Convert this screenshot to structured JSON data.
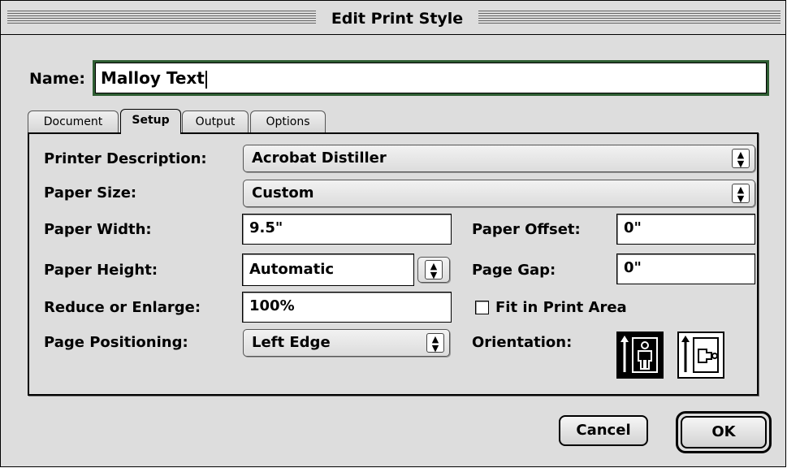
{
  "window": {
    "title": "Edit Print Style"
  },
  "name": {
    "label": "Name:",
    "value": "Malloy Text"
  },
  "tabs": [
    {
      "label": "Document",
      "active": false
    },
    {
      "label": "Setup",
      "active": true
    },
    {
      "label": "Output",
      "active": false
    },
    {
      "label": "Options",
      "active": false
    }
  ],
  "setup": {
    "printer_description": {
      "label": "Printer Description:",
      "value": "Acrobat Distiller"
    },
    "paper_size": {
      "label": "Paper Size:",
      "value": "Custom"
    },
    "paper_width": {
      "label": "Paper Width:",
      "value": "9.5\""
    },
    "paper_height": {
      "label": "Paper Height:",
      "value": "Automatic"
    },
    "reduce_enlarge": {
      "label": "Reduce or Enlarge:",
      "value": "100%"
    },
    "page_positioning": {
      "label": "Page Positioning:",
      "value": "Left Edge"
    },
    "paper_offset": {
      "label": "Paper Offset:",
      "value": "0\""
    },
    "page_gap": {
      "label": "Page Gap:",
      "value": "0\""
    },
    "fit_in_print_area": {
      "label": "Fit in Print Area",
      "checked": false
    },
    "orientation": {
      "label": "Orientation:",
      "selected": "portrait",
      "options": [
        "portrait-icon",
        "landscape-icon"
      ]
    }
  },
  "buttons": {
    "cancel": "Cancel",
    "ok": "OK"
  },
  "icons": {
    "popup_arrows": "up-down-arrows-icon"
  }
}
